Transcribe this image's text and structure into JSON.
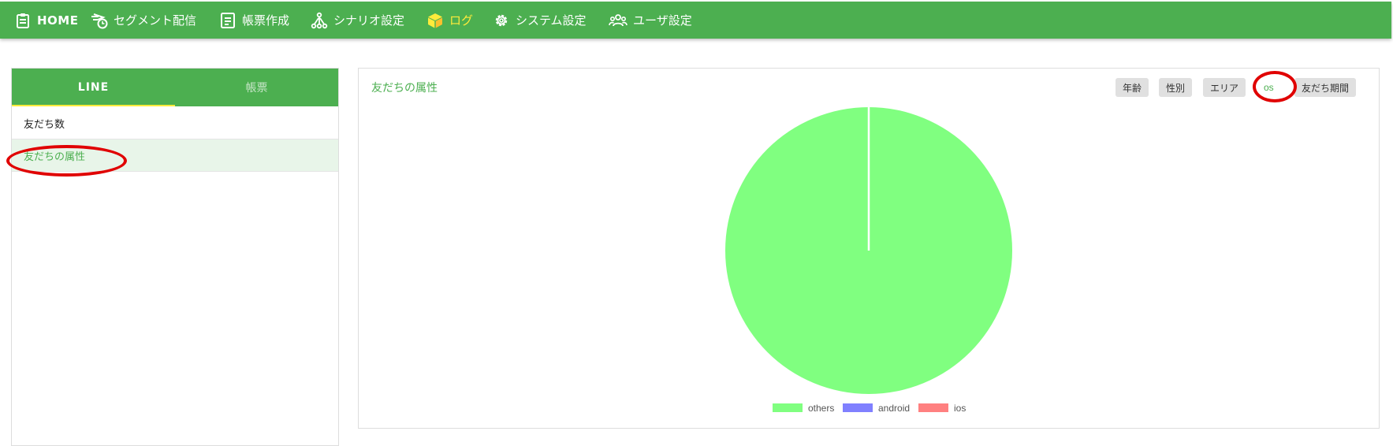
{
  "nav": {
    "items": [
      {
        "label": "HOME",
        "icon": "clipboard-icon"
      },
      {
        "label": "セグメント配信",
        "icon": "send-clock-icon"
      },
      {
        "label": "帳票作成",
        "icon": "document-icon"
      },
      {
        "label": "シナリオ設定",
        "icon": "flow-icon"
      },
      {
        "label": "ログ",
        "icon": "box-icon",
        "active": true
      },
      {
        "label": "システム設定",
        "icon": "gear-icon"
      },
      {
        "label": "ユーザ設定",
        "icon": "users-icon"
      }
    ]
  },
  "sidebar": {
    "tabs": [
      {
        "label": "LINE",
        "active": true
      },
      {
        "label": "帳票",
        "active": false
      }
    ],
    "items": [
      {
        "label": "友だち数"
      },
      {
        "label": "友だちの属性",
        "selected": true
      }
    ]
  },
  "main": {
    "title": "友だちの属性",
    "filters": [
      {
        "label": "年齢"
      },
      {
        "label": "性別"
      },
      {
        "label": "エリア"
      },
      {
        "label": "os",
        "active": true
      },
      {
        "label": "友だち期間"
      }
    ]
  },
  "chart_data": {
    "type": "pie",
    "categories": [
      "others",
      "android",
      "ios"
    ],
    "values": [
      100,
      0,
      0
    ],
    "colors": [
      "#80ff80",
      "#8080ff",
      "#ff8080"
    ],
    "legend": "bottom"
  },
  "colors": {
    "primary": "#4caf50",
    "active_nav": "#ffeb3b",
    "annotation": "#e00000"
  }
}
